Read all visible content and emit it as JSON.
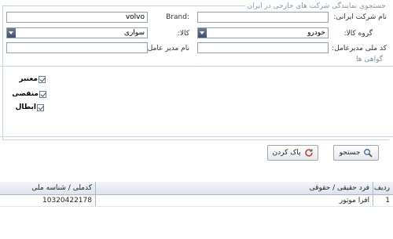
{
  "search_panel": {
    "legend": "جستجوی نمایندگی شرکت های خارجی در ایران",
    "company_name_label": "نام شرکت ایرانی:",
    "company_name_value": "",
    "brand_label": "Brand:",
    "brand_value": "volvo",
    "product_group_label": "گروه کالا:",
    "product_group_value": "خودرو",
    "product_label": "کالا:",
    "product_value": "سواری",
    "national_code_label": "کد ملی مدیرعامل:",
    "national_code_value": "",
    "ceo_name_label": "نام مدیر عامل:",
    "ceo_name_value": ""
  },
  "certificates": {
    "title": "گواهی ها",
    "items": [
      {
        "label": "معتبر",
        "checked": true
      },
      {
        "label": "منقضی",
        "checked": true
      },
      {
        "label": "ابطال",
        "checked": true
      }
    ]
  },
  "actions": {
    "search_label": "جستجو",
    "clear_label": "پاک کردن"
  },
  "results": {
    "columns": [
      "ردیف",
      "فرد حقیقی / حقوقی",
      "کدملی / شناسه ملی"
    ],
    "rows": [
      {
        "row": "1",
        "entity": "افرا موتور",
        "code": "10320422178"
      }
    ]
  }
}
